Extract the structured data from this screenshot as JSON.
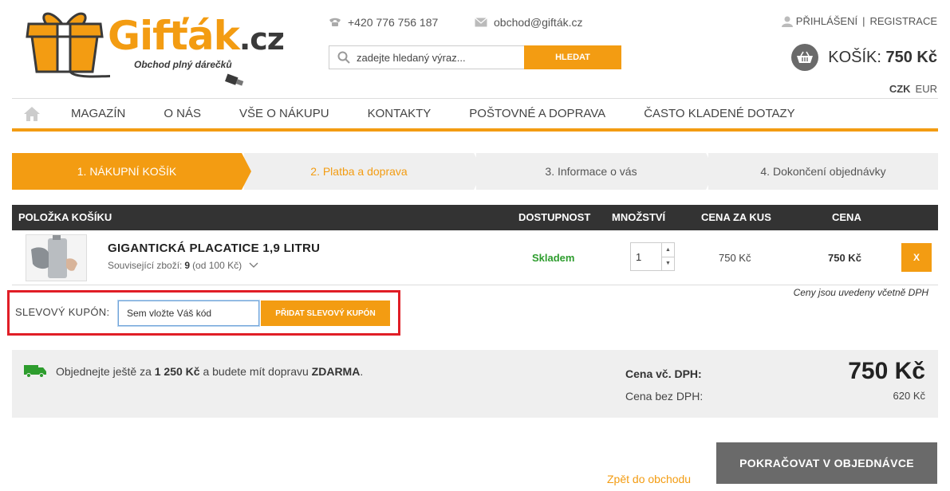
{
  "brand": {
    "name": "Gifťák",
    "tld": ".cz",
    "slogan": "Obchod plný dárečků",
    "accent_color": "#f39c12"
  },
  "header": {
    "phone": "+420 776 756 187",
    "email": "obchod@gifták.cz",
    "search_placeholder": "zadejte hledaný výraz...",
    "search_button": "HLEDAT",
    "login": "PŘIHLÁŠENÍ",
    "register": "REGISTRACE",
    "cart_label": "KOŠÍK:",
    "cart_total": "750 Kč",
    "currencies": [
      "CZK",
      "EUR"
    ]
  },
  "nav": {
    "items": [
      "MAGAZÍN",
      "O NÁS",
      "VŠE O NÁKUPU",
      "KONTAKTY",
      "POŠTOVNÉ A DOPRAVA",
      "ČASTO KLADENÉ DOTAZY"
    ]
  },
  "steps": [
    "1. NÁKUPNÍ KOŠÍK",
    "2. Platba a doprava",
    "3. Informace o vás",
    "4. Dokončení objednávky"
  ],
  "table": {
    "headers": {
      "item": "POLOŽKA KOŠÍKU",
      "availability": "DOSTUPNOST",
      "quantity": "MNOŽSTVÍ",
      "unit_price": "CENA ZA KUS",
      "price": "CENA"
    },
    "rows": [
      {
        "name": "GIGANTICKÁ PLACATICE 1,9 LITRU",
        "related_label": "Související zboží:",
        "related_count": "9",
        "related_from": "(od 100 Kč)",
        "availability": "Skladem",
        "quantity": "1",
        "unit_price": "750 Kč",
        "price": "750 Kč",
        "remove_label": "X"
      }
    ],
    "vat_note": "Ceny jsou uvedeny včetně DPH"
  },
  "coupon": {
    "label": "SLEVOVÝ KUPÓN:",
    "placeholder": "Sem vložte Váš kód",
    "button": "PŘIDAT SLEVOVÝ KUPÓN"
  },
  "summary": {
    "shipping_pre": "Objednejte ještě za",
    "shipping_amount": "1 250 Kč",
    "shipping_mid": "a budete mít dopravu",
    "shipping_free": "ZDARMA",
    "shipping_end": ".",
    "with_vat_label": "Cena vč. DPH:",
    "with_vat_value": "750 Kč",
    "without_vat_label": "Cena bez DPH:",
    "without_vat_value": "620 Kč"
  },
  "footer": {
    "back_link": "Zpět do obchodu",
    "continue_button": "POKRAČOVAT V OBJEDNÁVCE"
  }
}
